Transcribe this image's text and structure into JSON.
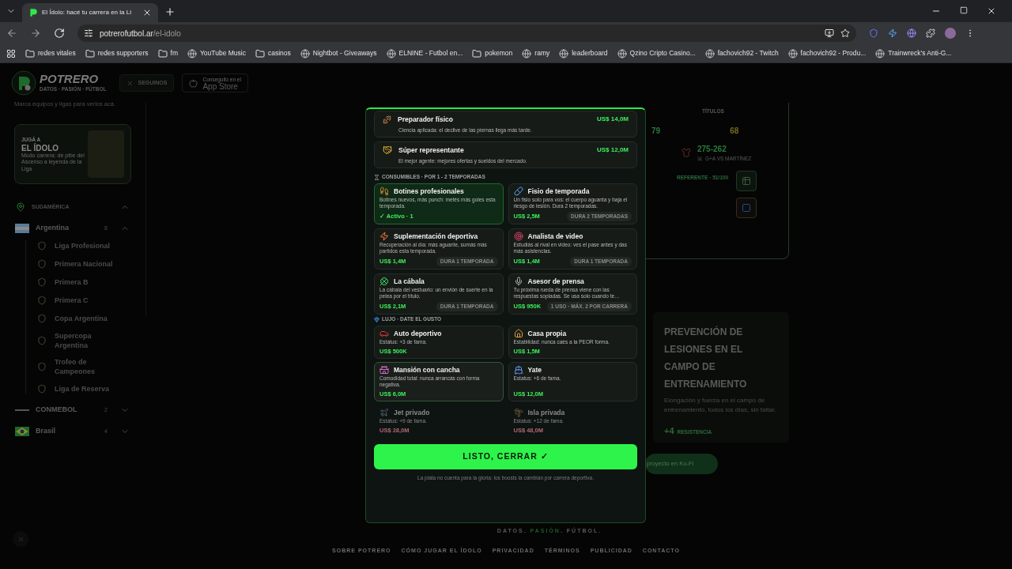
{
  "browser": {
    "tab_title": "El Ídolo: hacé tu carrera en la Li",
    "url_host": "potrerofutbol.ar",
    "url_path": "/el-idolo",
    "bookmarks": [
      {
        "kind": "folder",
        "label": "redes vitales"
      },
      {
        "kind": "folder",
        "label": "redes supporters"
      },
      {
        "kind": "folder",
        "label": "fm"
      },
      {
        "kind": "site",
        "label": "YouTube Music"
      },
      {
        "kind": "folder",
        "label": "casinos"
      },
      {
        "kind": "site",
        "label": "Nightbot - Giveaways"
      },
      {
        "kind": "site",
        "label": "ELNINE - Futbol en..."
      },
      {
        "kind": "folder",
        "label": "pokemon"
      },
      {
        "kind": "site",
        "label": "ramy"
      },
      {
        "kind": "site",
        "label": "leaderboard"
      },
      {
        "kind": "site",
        "label": "Qzino Cripto Casino..."
      },
      {
        "kind": "site",
        "label": "fachovich92 - Twitch"
      },
      {
        "kind": "site",
        "label": "fachovich92 - Produ..."
      },
      {
        "kind": "site",
        "label": "Trainwreck's Anti-G..."
      }
    ]
  },
  "header": {
    "brand": "POTRERO",
    "tagline": "DATOS · PASIÓN · FÚTBOL",
    "follow_button": "SEGUINOS",
    "store_caption": "Conseguilo en el",
    "store_name": "App Store"
  },
  "sidebar": {
    "hint": "Marca equipos y ligas para verlos acá.",
    "promo": {
      "kicker": "JUGÁ A",
      "title": "EL ÍDOLO",
      "text": "Modo carrera: de pibe del Ascenso a leyenda de la Liga"
    },
    "tree": [
      {
        "label": "SUDAMÉRICA",
        "expanded": true,
        "children": [
          {
            "label": "Argentina",
            "count": "8",
            "expanded": true,
            "children": [
              {
                "label": "Liga Profesional"
              },
              {
                "label": "Primera Nacional"
              },
              {
                "label": "Primera B"
              },
              {
                "label": "Primera C"
              },
              {
                "label": "Copa Argentina"
              },
              {
                "label": "Supercopa Argentina"
              },
              {
                "label": "Trofeo de Campeones"
              },
              {
                "label": "Liga de Reserva"
              }
            ]
          },
          {
            "label": "CONMEBOL",
            "count": "2",
            "expanded": false
          },
          {
            "label": "Brasil",
            "count": "4",
            "expanded": false
          }
        ]
      }
    ]
  },
  "stats": {
    "titles_label": "TÍTULOS",
    "left_value": "79",
    "right_value": "68",
    "record": "275-262",
    "record_label": "G+A VS MARTÍNEZ",
    "tier": "REFERENTE · 51/100"
  },
  "article": {
    "title": "PREVENCIÓN DE LESIONES EN EL CAMPO DE ENTRENAMIENTO",
    "text": "Elongación y fuerza en el campo de entrenamiento, todos los días, sin faltar.",
    "bonus": "+4",
    "bonus_label": "RESISTENCIA"
  },
  "kofi_button": "proyecto en Ko-Fi",
  "footer": {
    "tagline_parts": [
      "DATOS. ",
      "PASIÓN",
      ". FÚTBOL."
    ],
    "links": [
      "SOBRE POTRERO",
      "CÓMO JUGAR EL ÍDOLO",
      "PRIVACIDAD",
      "TÉRMINOS",
      "PUBLICIDAD",
      "CONTACTO"
    ]
  },
  "modal": {
    "permanent": [
      {
        "title": "Preparador físico",
        "desc": "Ciencia aplicada: el declive de las piernas llega más tarde.",
        "price": "US$ 14,0M"
      },
      {
        "title": "Súper representante",
        "desc": "El mejor agente: mejores ofertas y sueldos del mercado.",
        "price": "US$ 12,0M"
      }
    ],
    "sections": [
      {
        "kind": "consumables",
        "heading": "CONSUMIBLES · POR 1 - 2 TEMPORADAS",
        "items": [
          {
            "title": "Botines profesionales",
            "desc": "Botines nuevos, más punch: metés más goles esta temporada.",
            "active": true,
            "status": "✓ Activo · 1"
          },
          {
            "title": "Fisio de temporada",
            "desc": "Un fisio solo para vos: el cuerpo aguanta y baja el riesgo de lesión. Dura 2 temporadas.",
            "active": false,
            "price": "US$ 2,5M",
            "badge": "DURA 2 TEMPORADAS"
          },
          {
            "title": "Suplementación deportiva",
            "desc": "Recuperación al día: más aguante, sumás más partidos esta temporada.",
            "active": false,
            "price": "US$ 1,4M",
            "badge": "DURA 1 TEMPORADA"
          },
          {
            "title": "Analista de video",
            "desc": "Estudiás al rival en video: ves el pase antes y das más asistencias.",
            "active": false,
            "price": "US$ 1,4M",
            "badge": "DURA 1 TEMPORADA"
          },
          {
            "title": "La cábala",
            "desc": "La cábala del vestuario: un envión de suerte en la pelea por el título.",
            "active": false,
            "price": "US$ 2,1M",
            "badge": "DURA 1 TEMPORADA"
          },
          {
            "title": "Asesor de prensa",
            "desc": "Tu próxima rueda de prensa viene con las respuestas sopladas. Se usa solo cuando te…",
            "active": false,
            "price": "US$ 950K",
            "badge": "1 USO · MÁX. 2 POR CARRERA"
          }
        ]
      },
      {
        "kind": "luxury",
        "heading": "LUJO · DATE EL GUSTO",
        "items": [
          {
            "title": "Auto deportivo",
            "desc": "Estatus: +3 de fama.",
            "price": "US$ 500K",
            "disabled": false,
            "hovered": false
          },
          {
            "title": "Casa propia",
            "desc": "Estabilidad: nunca caés a la PEOR forma.",
            "price": "US$ 1,5M",
            "disabled": false,
            "hovered": false
          },
          {
            "title": "Mansión con cancha",
            "desc": "Comodidad total: nunca arrancás con forma negativa.",
            "price": "US$ 6,0M",
            "disabled": false,
            "hovered": true
          },
          {
            "title": "Yate",
            "desc": "Estatus: +6 de fama.",
            "price": "US$ 12,0M",
            "disabled": false,
            "hovered": false
          },
          {
            "title": "Jet privado",
            "desc": "Estatus: +9 de fama.",
            "price": "US$ 28,0M",
            "disabled": true,
            "hovered": false
          },
          {
            "title": "Isla privada",
            "desc": "Estatus: +12 de fama.",
            "price": "US$ 48,0M",
            "disabled": true,
            "hovered": false
          }
        ]
      }
    ],
    "confirm_button": "LISTO, CERRAR ✓",
    "footnote": "La plata no cuenta para la gloria: los boosts la cambian por carrera deportiva."
  }
}
